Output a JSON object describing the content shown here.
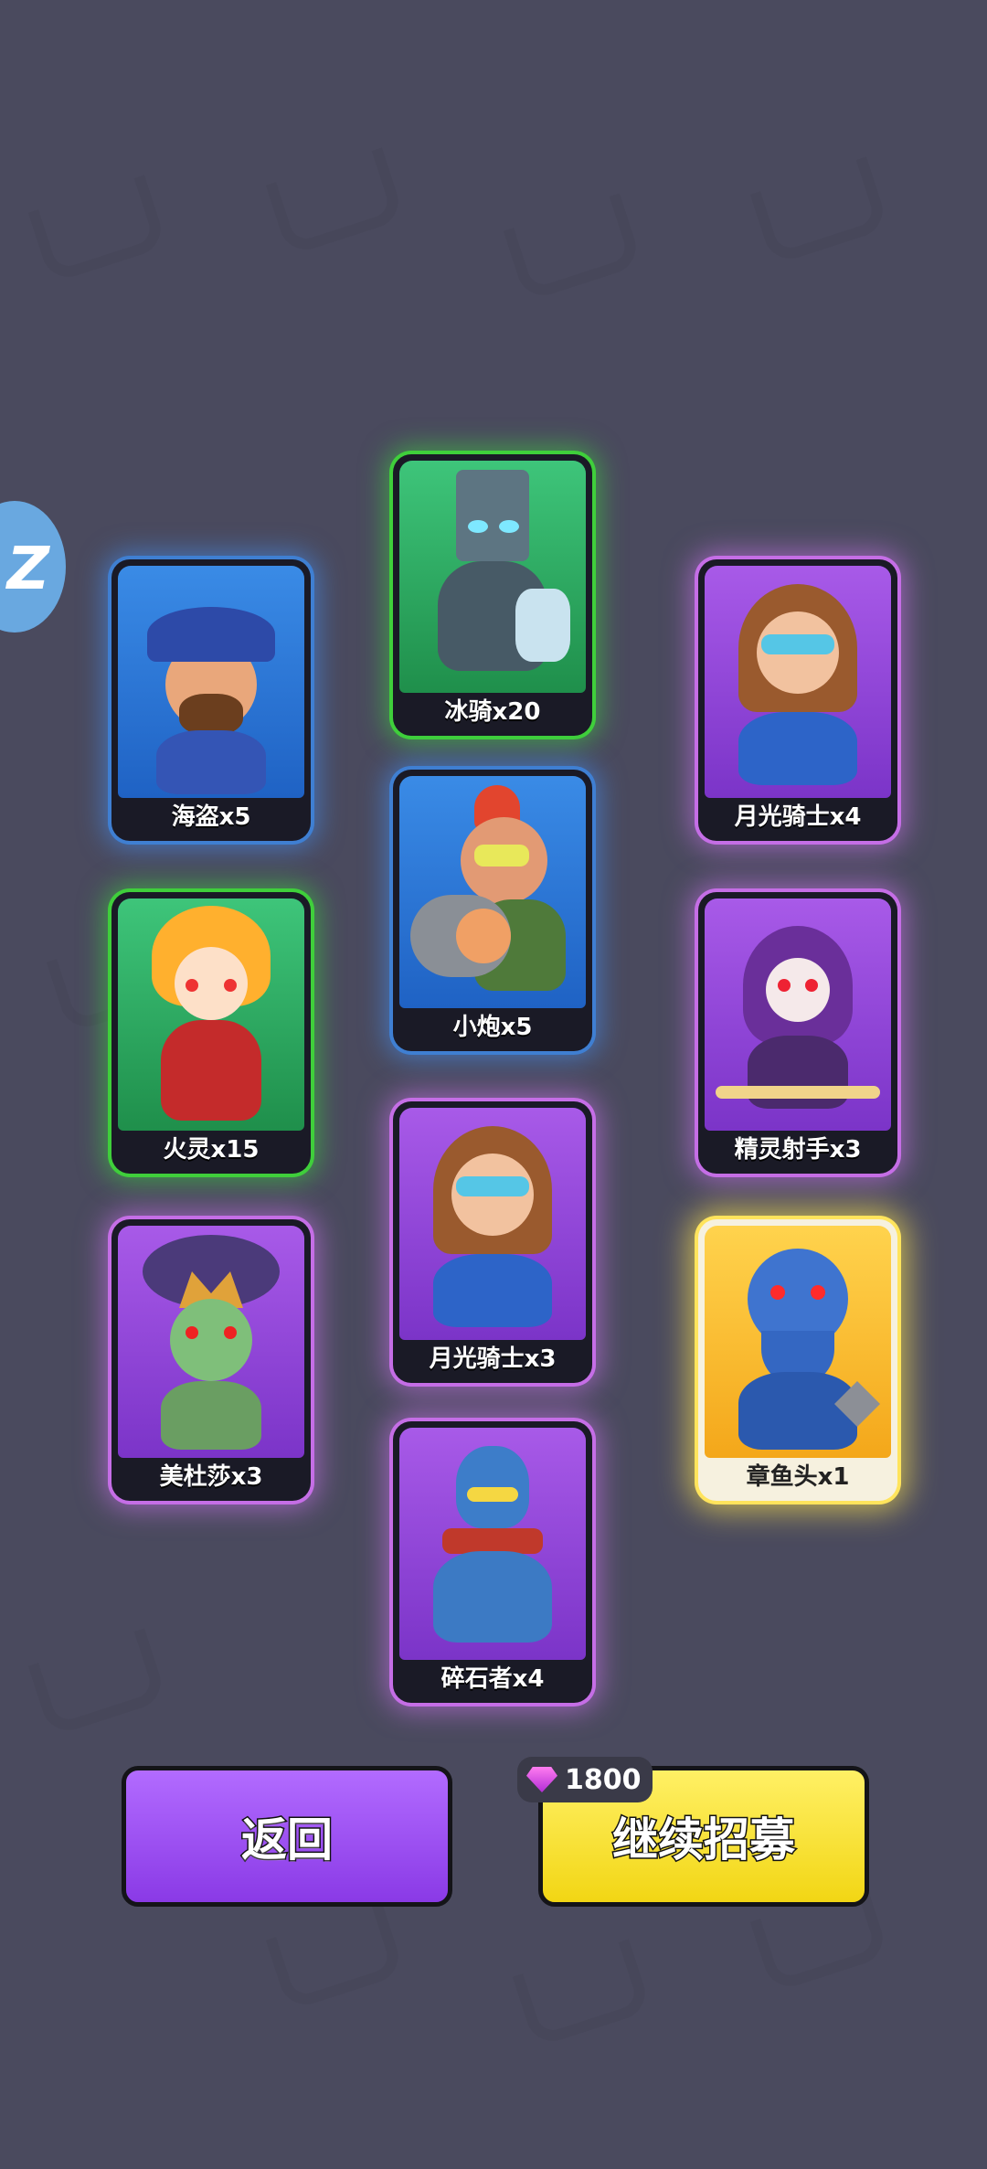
{
  "cards": [
    {
      "name": "海盗x5",
      "rarity": "blue",
      "icon": "pirate-icon"
    },
    {
      "name": "冰骑x20",
      "rarity": "green",
      "icon": "ice-knight-icon"
    },
    {
      "name": "月光骑士x4",
      "rarity": "purple",
      "icon": "moonlight-knight-icon"
    },
    {
      "name": "小炮x5",
      "rarity": "blue",
      "icon": "cannon-icon"
    },
    {
      "name": "火灵x15",
      "rarity": "green",
      "icon": "fire-spirit-icon"
    },
    {
      "name": "精灵射手x3",
      "rarity": "purple",
      "icon": "elf-archer-icon"
    },
    {
      "name": "美杜莎x3",
      "rarity": "purple",
      "icon": "medusa-icon"
    },
    {
      "name": "月光骑士x3",
      "rarity": "purple",
      "icon": "moonlight-knight-icon"
    },
    {
      "name": "章鱼头x1",
      "rarity": "gold",
      "icon": "octopus-head-icon"
    },
    {
      "name": "碎石者x4",
      "rarity": "purple",
      "icon": "stone-breaker-icon"
    }
  ],
  "buttons": {
    "back_label": "返回",
    "recruit_label": "继续招募",
    "recruit_cost": "1800",
    "cost_icon": "gem-icon"
  },
  "colors": {
    "background": "#4a4a5e",
    "back_button": "#9b4cf2",
    "recruit_button": "#f7e030",
    "rare": "#3f7fd2",
    "uncommon": "#3fcf3b",
    "epic": "#c56ee6",
    "legendary": "#ffe45c"
  }
}
